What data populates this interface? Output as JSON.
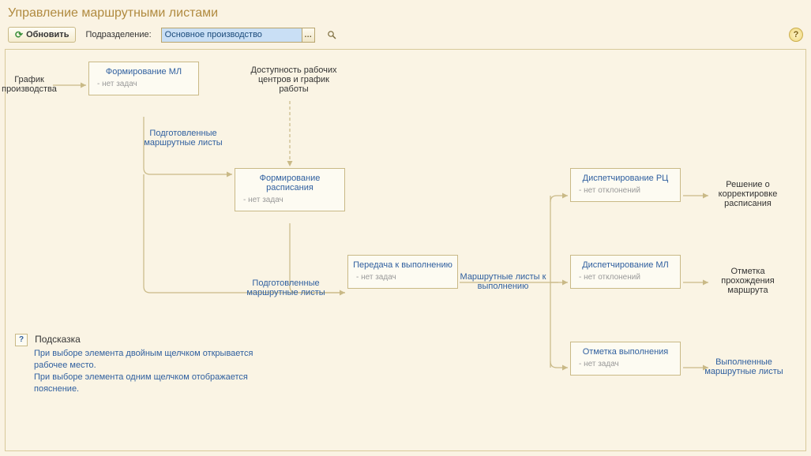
{
  "header": {
    "title": "Управление маршрутными листами"
  },
  "toolbar": {
    "refresh_label": "Обновить",
    "subdivision_label": "Подразделение:",
    "subdivision_value": "Основное производство"
  },
  "nodes": {
    "form_ml": {
      "title": "Формирование МЛ",
      "sub": "- нет задач"
    },
    "form_sched": {
      "title": "Формирование расписания",
      "sub": "- нет задач"
    },
    "transfer": {
      "title": "Передача к выполнению",
      "sub": "- нет задач"
    },
    "disp_rc": {
      "title": "Диспетчирование РЦ",
      "sub": "- нет отклонений"
    },
    "disp_ml": {
      "title": "Диспетчирование МЛ",
      "sub": "- нет отклонений"
    },
    "mark_done": {
      "title": "Отметка выполнения",
      "sub": "- нет задач"
    }
  },
  "labels": {
    "input_graph": "График производства",
    "avail_centers": "Доступность рабочих центров и график работы",
    "prepared_routes_1": "Подготовленные маршрутные листы",
    "prepared_routes_2": "Подготовленные маршрутные листы",
    "routes_to_exec": "Маршрутные листы к выполнению",
    "decision_correct": "Решение о корректировке расписания",
    "mark_pass": "Отметка прохождения маршрута",
    "done_routes": "Выполненные маршрутные листы"
  },
  "hint": {
    "title": "Подсказка",
    "line1": "При выборе элемента двойным щелчком открывается рабочее место.",
    "line2": "При выборе элемента одним щелчком отображается пояснение."
  }
}
